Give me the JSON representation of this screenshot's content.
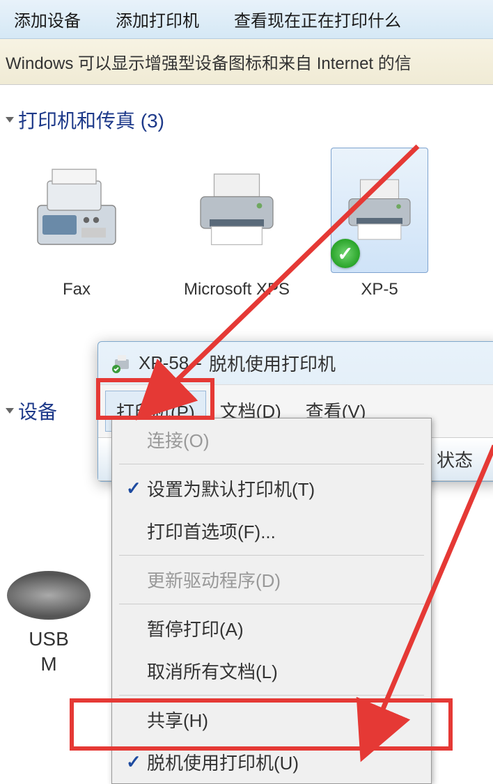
{
  "toolbar": {
    "add_device": "添加设备",
    "add_printer": "添加打印机",
    "view_printing": "查看现在正在打印什么"
  },
  "infobar_text": "Windows 可以显示增强型设备图标和来自 Internet 的信",
  "section_printers": "打印机和传真 (3)",
  "section_devices": "设备",
  "devices": [
    {
      "label": "Fax"
    },
    {
      "label": "Microsoft XPS"
    },
    {
      "label": "XP-5"
    }
  ],
  "usb": {
    "line1": "USB",
    "line2": "M"
  },
  "printer_window": {
    "title": "XP-58",
    "subtitle": "脱机使用打印机",
    "menu_printer": "打印机(P)",
    "menu_document": "文档(D)",
    "menu_view": "查看(V)",
    "col_status": "状态"
  },
  "dropdown": {
    "connect": "连接(O)",
    "set_default": "设置为默认打印机(T)",
    "preferences": "打印首选项(F)...",
    "update_driver": "更新驱动程序(D)",
    "pause": "暂停打印(A)",
    "cancel_all": "取消所有文档(L)",
    "share": "共享(H)",
    "offline": "脱机使用打印机(U)"
  }
}
